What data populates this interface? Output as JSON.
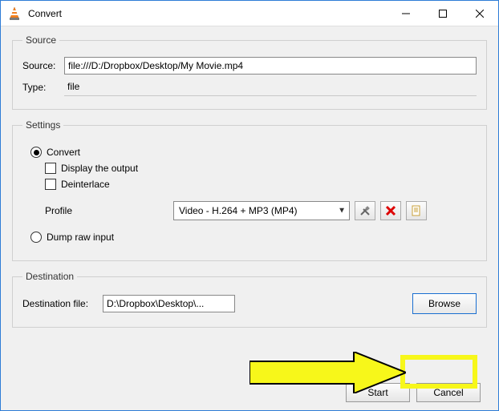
{
  "window": {
    "title": "Convert"
  },
  "source": {
    "legend": "Source",
    "source_label": "Source:",
    "source_value": "file:///D:/Dropbox/Desktop/My Movie.mp4",
    "type_label": "Type:",
    "type_value": "file"
  },
  "settings": {
    "legend": "Settings",
    "convert_label": "Convert",
    "display_output_label": "Display the output",
    "deinterlace_label": "Deinterlace",
    "profile_label": "Profile",
    "profile_value": "Video - H.264 + MP3 (MP4)",
    "dump_raw_label": "Dump raw input"
  },
  "destination": {
    "legend": "Destination",
    "dest_label": "Destination file:",
    "dest_value": "D:\\Dropbox\\Desktop\\...",
    "browse_label": "Browse"
  },
  "footer": {
    "start_label": "Start",
    "cancel_label": "Cancel"
  }
}
